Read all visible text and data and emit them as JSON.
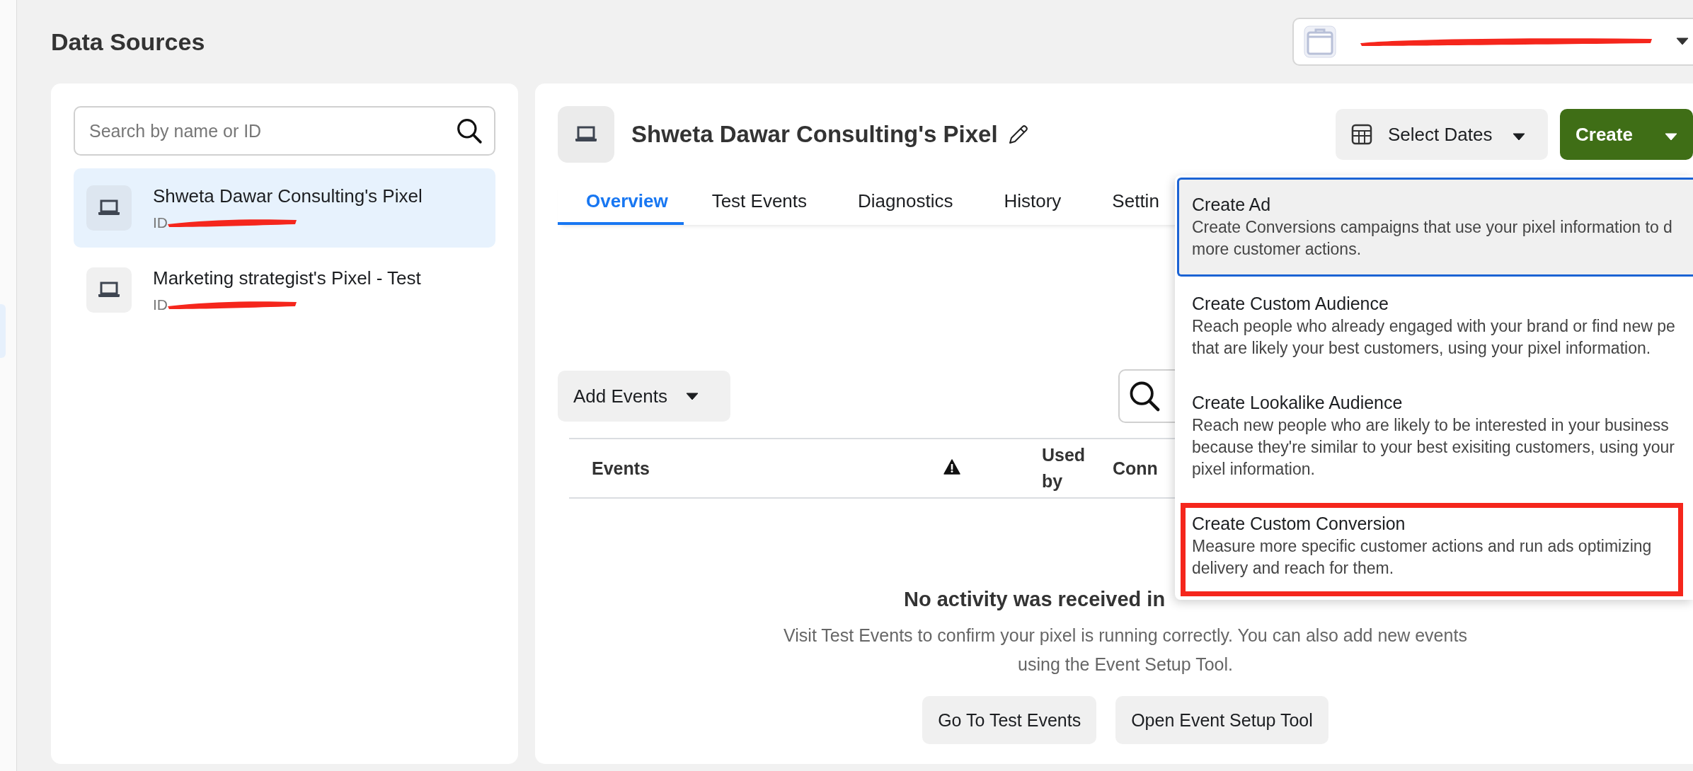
{
  "page_title": "Data Sources",
  "account_selector": {
    "redacted": true
  },
  "search": {
    "placeholder": "Search by name or ID"
  },
  "sources": [
    {
      "name": "Shweta Dawar Consulting's Pixel",
      "id_label": "ID",
      "id_redacted": true,
      "selected": true
    },
    {
      "name": "Marketing strategist's Pixel - Test",
      "id_label": "ID",
      "id_redacted": true,
      "selected": false
    }
  ],
  "pixel": {
    "title": "Shweta Dawar Consulting's Pixel"
  },
  "tabs": [
    {
      "label": "Overview",
      "selected": true
    },
    {
      "label": "Test Events",
      "selected": false
    },
    {
      "label": "Diagnostics",
      "selected": false
    },
    {
      "label": "History",
      "selected": false
    },
    {
      "label": "Settin",
      "selected": false
    }
  ],
  "date_button": "Select Dates",
  "create_button": "Create",
  "add_events_button": "Add Events",
  "table": {
    "columns": [
      {
        "kind": "text",
        "label": "Events"
      },
      {
        "kind": "warning"
      },
      {
        "kind": "text",
        "label": "Used by"
      },
      {
        "kind": "text",
        "label": "Conn"
      }
    ]
  },
  "empty_state": {
    "title": "No activity was received in",
    "message": "Visit Test Events to confirm your pixel is running correctly. You can also add new events using the Event Setup Tool.",
    "buttons": [
      "Go To Test Events",
      "Open Event Setup Tool"
    ]
  },
  "create_menu": {
    "items": [
      {
        "title": "Create Ad",
        "lines": [
          "Create Conversions campaigns that use your pixel information to d",
          "more customer actions."
        ],
        "selected": true,
        "annotated": false
      },
      {
        "title": "Create Custom Audience",
        "lines": [
          "Reach people who already engaged with your brand or find new pe",
          "that are likely your best customers, using your pixel information."
        ],
        "selected": false,
        "annotated": false
      },
      {
        "title": "Create Lookalike Audience",
        "lines": [
          "Reach new people who are likely to be interested in your business",
          "because they're similar to your best exisiting customers, using your",
          "pixel information."
        ],
        "selected": false,
        "annotated": false
      },
      {
        "title": "Create Custom Conversion",
        "lines": [
          "Measure more specific customer actions and run ads optimizing",
          "delivery and reach for them."
        ],
        "selected": false,
        "annotated": true
      }
    ]
  }
}
